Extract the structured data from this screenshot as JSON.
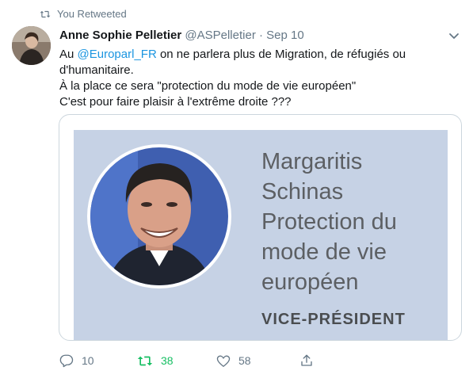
{
  "retweet_context": {
    "label": "You Retweeted",
    "icon": "retweet-icon"
  },
  "tweet": {
    "author_name": "Anne Sophie Pelletier",
    "handle": "@ASPelletier",
    "separator": "·",
    "date": "Sep 10",
    "text": {
      "prefix": "Au ",
      "mention": "@Europarl_FR",
      "line1_rest": " on ne parlera plus de Migration, de réfugiés ou d'humanitaire.",
      "line2": "À la place ce sera \"protection du mode de vie européen\"",
      "line3": "C'est pour faire plaisir à l'extrême droite ???"
    }
  },
  "card": {
    "title_lines": [
      "Margaritis",
      "Schinas",
      "Protection du",
      "mode de vie",
      "européen"
    ],
    "role": "VICE-PRÉSIDENT"
  },
  "actions": {
    "replies": "10",
    "retweets": "38",
    "likes": "58"
  },
  "colors": {
    "mention": "#1b95e0",
    "retweet_active": "#17bf63",
    "card_background": "#c6d2e5",
    "muted": "#657786"
  }
}
